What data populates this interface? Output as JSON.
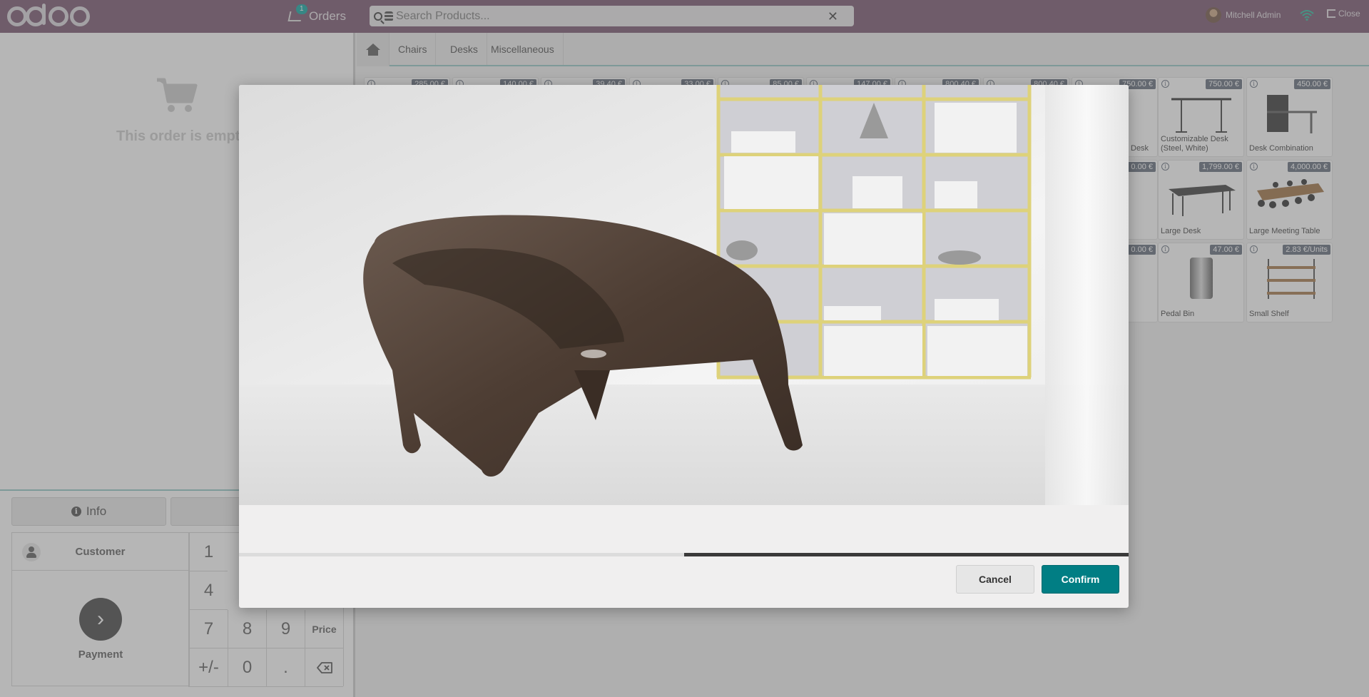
{
  "header": {
    "app": "odoo",
    "orders_label": "Orders",
    "orders_badge": "1",
    "search_placeholder": "Search Products...",
    "user_name": "Mitchell Admin",
    "close_label": "Close"
  },
  "order": {
    "empty_text": "This order is empty"
  },
  "actions": {
    "info_label": "Info"
  },
  "numpad": {
    "customer_label": "Customer",
    "payment_label": "Payment",
    "keys": [
      "1",
      "4",
      "7",
      "8",
      "9",
      "Price",
      "+/-",
      "0",
      "."
    ]
  },
  "categories": [
    "Chairs",
    "Desks",
    "Miscellaneous"
  ],
  "products_partial_prices": [
    "285.00 €",
    "140.00 €",
    "39.40 €",
    "33.00 €",
    "85.00 €",
    "147.00 €",
    "800.40 €",
    "800.40 €",
    "750.00 €",
    "0.00 €",
    "0.00 €"
  ],
  "products_partial_names": [
    "Desk"
  ],
  "products": [
    {
      "name": "Customizable Desk (Steel, White)",
      "price": "750.00 €"
    },
    {
      "name": "Desk Combination",
      "price": "450.00 €"
    },
    {
      "name": "Large Desk",
      "price": "1,799.00 €"
    },
    {
      "name": "Large Meeting Table",
      "price": "4,000.00 €"
    },
    {
      "name": "Pedal Bin",
      "price": "47.00 €"
    },
    {
      "name": "Small Shelf",
      "price": "2.83 €/Units"
    }
  ],
  "dialog": {
    "image_subject": "brown plastic lounge chair in front of shelving unit",
    "progress_fraction": 0.5,
    "cancel_label": "Cancel",
    "confirm_label": "Confirm"
  },
  "colors": {
    "header_bg": "#714b67",
    "accent": "#017e84",
    "badge": "#00a09d",
    "price_tag": "#5a6475"
  }
}
